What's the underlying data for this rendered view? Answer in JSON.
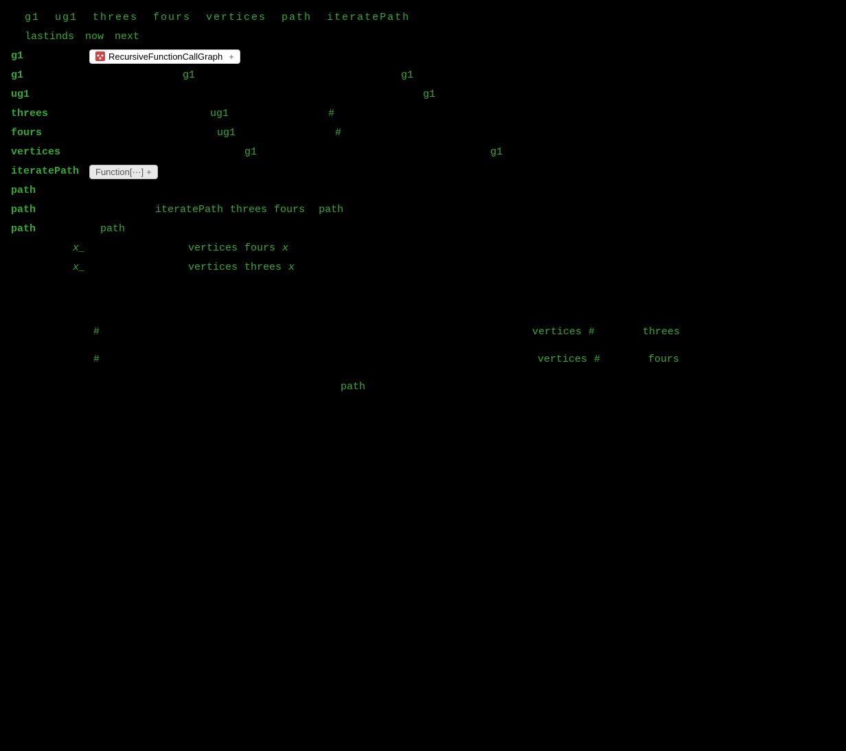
{
  "header": {
    "variables": "g1  ug1  threes  fours  vertices  path  iteratePath",
    "lastinds_label": "lastinds",
    "now_label": "now",
    "next_label": "next"
  },
  "rows": [
    {
      "id": "row_g1_label",
      "label": "g1",
      "widget": "RecursiveFunctionCallGraph",
      "widget_type": "rfcg"
    },
    {
      "id": "row_g1_data",
      "label": "g1",
      "cols": [
        "g1",
        "",
        "",
        "",
        "",
        "g1"
      ]
    },
    {
      "id": "row_ug1",
      "label": "ug1",
      "cols": [
        "",
        "",
        "",
        "",
        "g1"
      ]
    },
    {
      "id": "row_threes",
      "label": "threes",
      "cols": [
        "",
        "ug1",
        "",
        "#"
      ]
    },
    {
      "id": "row_fours",
      "label": "fours",
      "cols": [
        "",
        "ug1",
        "",
        "#"
      ]
    },
    {
      "id": "row_vertices",
      "label": "vertices",
      "cols": [
        "",
        "",
        "",
        "g1",
        "",
        "",
        "g1"
      ]
    },
    {
      "id": "row_iteratePath",
      "label": "iteratePath",
      "widget": "Function[...]",
      "widget_type": "func"
    },
    {
      "id": "row_path_empty",
      "label": "path",
      "cols": []
    },
    {
      "id": "row_path_data",
      "label": "path",
      "cols": [
        "",
        "iteratePath",
        "threes",
        "fours",
        "",
        "path"
      ]
    },
    {
      "id": "row_path_path",
      "label": "path",
      "sub": "path",
      "cols": []
    },
    {
      "id": "row_x1",
      "indent": "x_",
      "cols": [
        "",
        "",
        "vertices",
        "fours",
        "x"
      ]
    },
    {
      "id": "row_x2",
      "indent": "x_",
      "cols": [
        "",
        "",
        "vertices",
        "threes",
        "x"
      ]
    }
  ],
  "bottom": {
    "line1": {
      "hash": "#",
      "vertices": "vertices",
      "hash2": "#",
      "threes": "threes"
    },
    "line2": {
      "hash": "#",
      "vertices": "vertices",
      "hash2": "#",
      "fours": "fours"
    },
    "line3": {
      "path": "path"
    }
  },
  "icons": {
    "rfcg_icon": "●",
    "plus_icon": "+"
  }
}
